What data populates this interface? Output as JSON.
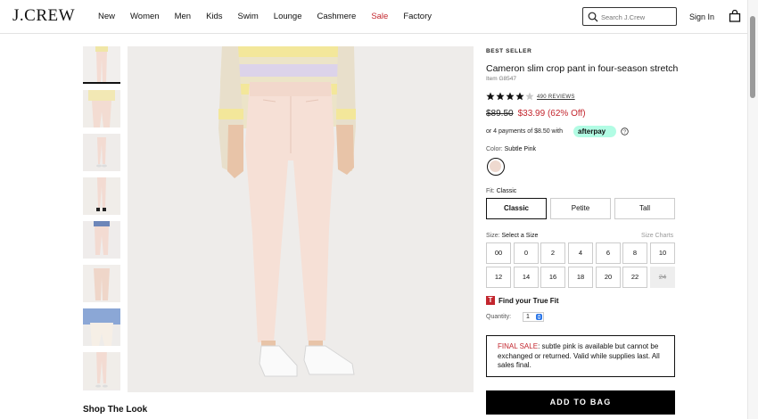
{
  "header": {
    "logo": "J.CREW",
    "nav": [
      "New",
      "Women",
      "Men",
      "Kids",
      "Swim",
      "Lounge",
      "Cashmere",
      "Sale",
      "Factory"
    ],
    "search_placeholder": "Search J.Crew",
    "sign_in": "Sign In"
  },
  "gallery": {
    "thumbnail_count": 8,
    "active_thumbnail": 1,
    "section_title": "Shop The Look"
  },
  "product": {
    "badge": "BEST SELLER",
    "title": "Cameron slim crop pant in four-season stretch",
    "item": "Item G8547",
    "rating": 4,
    "reviews": "490 REVIEWS",
    "original_price": "$89.50",
    "sale_price": "$33.99 (62% Off)",
    "installments": "or 4 payments of $8.50 with",
    "afterpay": "afterpay",
    "color_label": "Color:",
    "color_value": "Subtle Pink",
    "fit_label": "Fit:",
    "fit_value": "Classic",
    "fits": [
      "Classic",
      "Petite",
      "Tall"
    ],
    "size_label": "Size:",
    "size_value": "Select a Size",
    "size_charts": "Size Charts",
    "sizes": [
      "00",
      "0",
      "2",
      "4",
      "6",
      "8",
      "10",
      "12",
      "14",
      "16",
      "18",
      "20",
      "22",
      "24"
    ],
    "unavailable_size": "24",
    "true_fit": "Find your True Fit",
    "quantity_label": "Quantity:",
    "quantity_value": "1",
    "final_sale_label": "FINAL SALE",
    "final_sale_text": ": subtle pink is available but cannot be exchanged or returned. Valid while supplies last. All sales final.",
    "add_to_bag": "ADD TO BAG"
  },
  "colors": {
    "sale_red": "#c3262e",
    "afterpay_mint": "#b2fce4",
    "swatch_pink": "#eed9cf"
  }
}
